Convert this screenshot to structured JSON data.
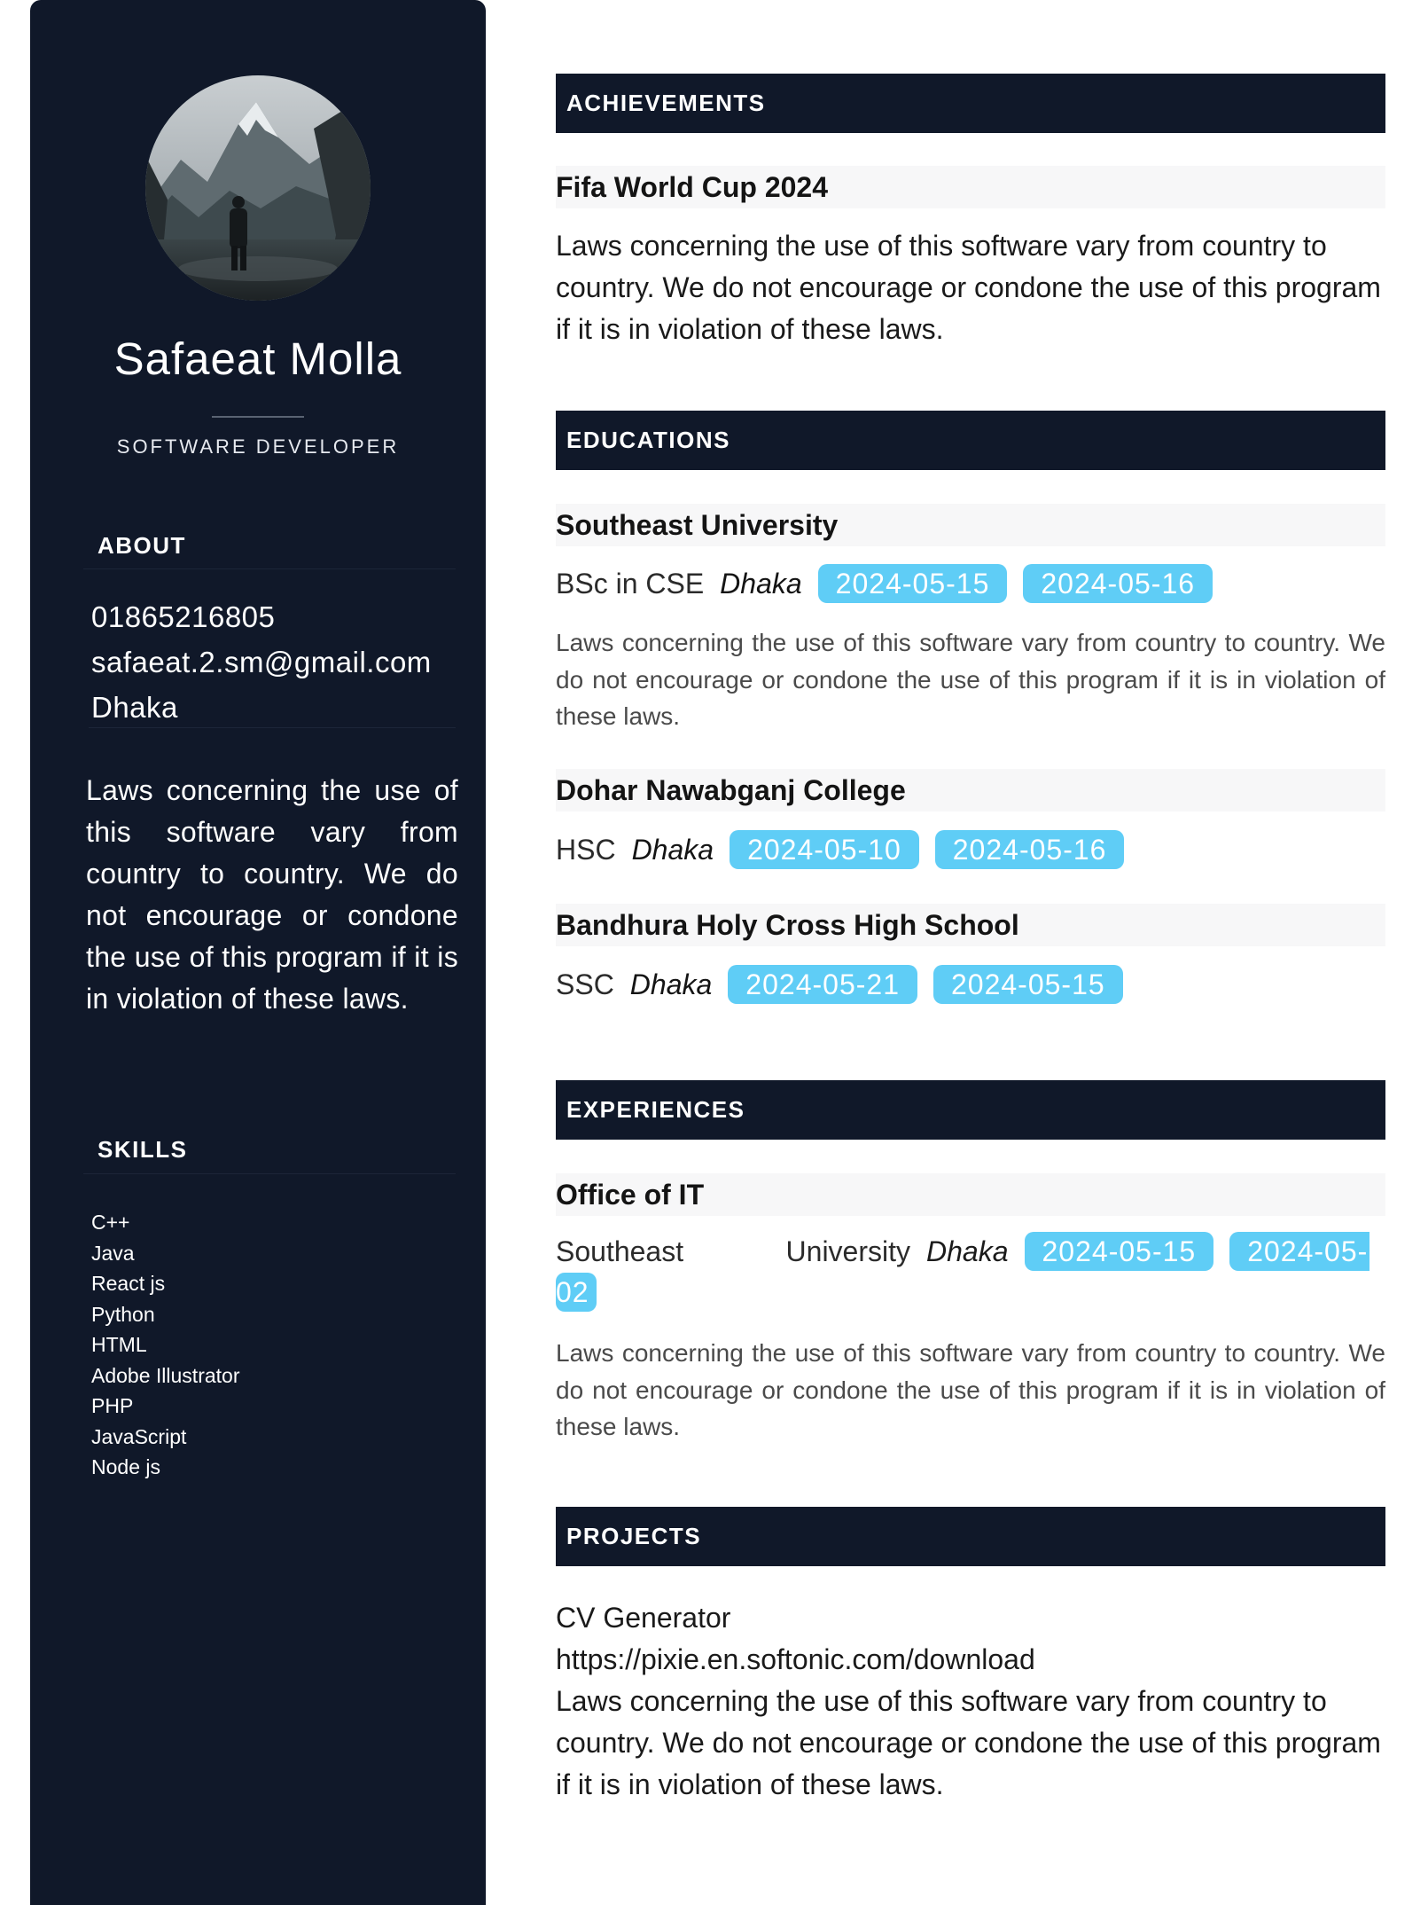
{
  "profile": {
    "name": "Safaeat Molla",
    "title": "SOFTWARE DEVELOPER"
  },
  "about": {
    "heading": "ABOUT",
    "phone": "01865216805",
    "email": "safaeat.2.sm@gmail.com",
    "location": "Dhaka",
    "text": "Laws concerning the use of this software vary from country to country. We do not encourage or condone the use of this program if it is in violation of these laws."
  },
  "skills": {
    "heading": "SKILLS",
    "items": [
      "C++",
      "Java",
      "React js",
      "Python",
      "HTML",
      "Adobe Illustrator",
      "PHP",
      "JavaScript",
      "Node js"
    ]
  },
  "achievements": {
    "heading": "ACHIEVEMENTS",
    "items": [
      {
        "title": "Fifa World Cup 2024",
        "text": "Laws concerning the use of this software vary from country to country. We do not encourage or condone the use of this program if it is in violation of these laws."
      }
    ]
  },
  "educations": {
    "heading": "EDUCATIONS",
    "items": [
      {
        "institution": "Southeast University",
        "degree": "BSc in CSE",
        "location": "Dhaka",
        "start": "2024-05-15",
        "end": "2024-05-16",
        "text": "Laws concerning the use of this software vary from country to country. We do not encourage or condone the use of this program if it is in violation of these laws."
      },
      {
        "institution": "Dohar Nawabganj College",
        "degree": "HSC",
        "location": "Dhaka",
        "start": "2024-05-10",
        "end": "2024-05-16"
      },
      {
        "institution": "Bandhura Holy Cross High School",
        "degree": "SSC",
        "location": "Dhaka",
        "start": "2024-05-21",
        "end": "2024-05-15"
      }
    ]
  },
  "experiences": {
    "heading": "EXPERIENCES",
    "items": [
      {
        "role": "Office of IT",
        "organization": "Southeast University",
        "location": "Dhaka",
        "start": "2024-05-15",
        "end": "2024-05-02",
        "text": "Laws concerning the use of this software vary from country to country. We do not encourage or condone the use of this program if it is in violation of these laws."
      }
    ]
  },
  "projects": {
    "heading": "PROJECTS",
    "items": [
      {
        "name": "CV Generator",
        "link": "https://pixie.en.softonic.com/download",
        "text": "Laws concerning the use of this software vary from country to country. We do not encourage or condone the use of this program if it is in violation of these laws."
      }
    ]
  }
}
